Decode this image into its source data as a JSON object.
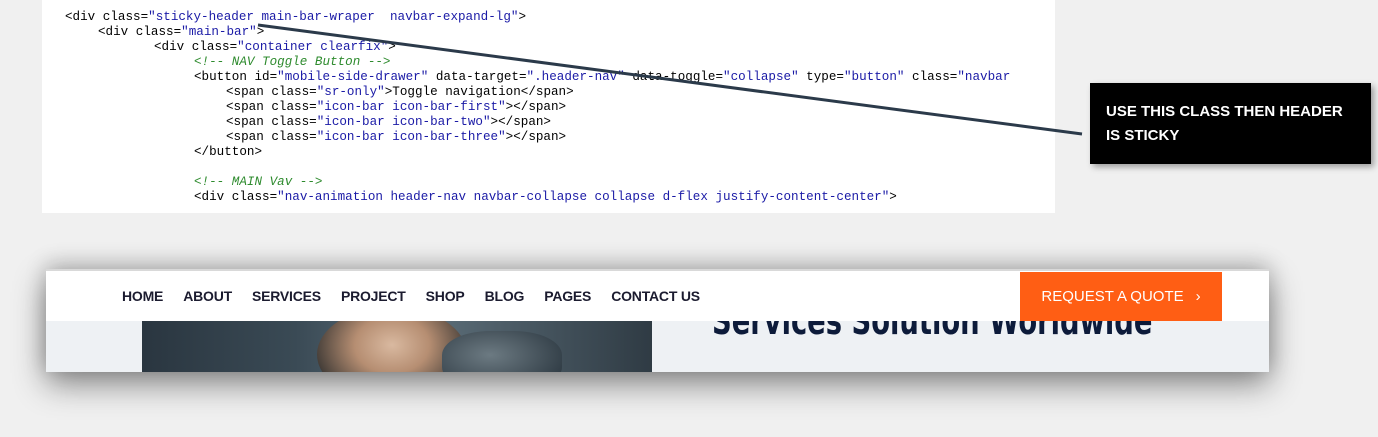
{
  "code": {
    "lines": [
      [
        {
          "t": "k",
          "s": "<div class="
        },
        {
          "t": "v",
          "s": "\"sticky-header main-bar-wraper  navbar-expand-lg\""
        },
        {
          "t": "k",
          "s": ">"
        }
      ],
      [
        {
          "t": "k",
          "s": "<div class="
        },
        {
          "t": "v",
          "s": "\"main-bar\""
        },
        {
          "t": "k",
          "s": ">"
        }
      ],
      [
        {
          "t": "k",
          "s": "<div class="
        },
        {
          "t": "v",
          "s": "\"container clearfix\""
        },
        {
          "t": "k",
          "s": ">"
        }
      ],
      [
        {
          "t": "c",
          "s": "<!-- NAV Toggle Button -->"
        }
      ],
      [
        {
          "t": "k",
          "s": "<button id="
        },
        {
          "t": "v",
          "s": "\"mobile-side-drawer\""
        },
        {
          "t": "k",
          "s": " data-target="
        },
        {
          "t": "v",
          "s": "\".header-nav\""
        },
        {
          "t": "k",
          "s": " data-toggle="
        },
        {
          "t": "v",
          "s": "\"collapse\""
        },
        {
          "t": "k",
          "s": " type="
        },
        {
          "t": "v",
          "s": "\"button\""
        },
        {
          "t": "k",
          "s": " class="
        },
        {
          "t": "v",
          "s": "\"navbar"
        }
      ],
      [
        {
          "t": "k",
          "s": "<span class="
        },
        {
          "t": "v",
          "s": "\"sr-only\""
        },
        {
          "t": "k",
          "s": ">Toggle navigation</span>"
        }
      ],
      [
        {
          "t": "k",
          "s": "<span class="
        },
        {
          "t": "v",
          "s": "\"icon-bar icon-bar-first\""
        },
        {
          "t": "k",
          "s": "></span>"
        }
      ],
      [
        {
          "t": "k",
          "s": "<span class="
        },
        {
          "t": "v",
          "s": "\"icon-bar icon-bar-two\""
        },
        {
          "t": "k",
          "s": "></span>"
        }
      ],
      [
        {
          "t": "k",
          "s": "<span class="
        },
        {
          "t": "v",
          "s": "\"icon-bar icon-bar-three\""
        },
        {
          "t": "k",
          "s": "></span>"
        }
      ],
      [
        {
          "t": "k",
          "s": "</button>"
        }
      ],
      [],
      [
        {
          "t": "c",
          "s": "<!-- MAIN Vav -->"
        }
      ],
      [
        {
          "t": "k",
          "s": "<div class="
        },
        {
          "t": "v",
          "s": "\"nav-animation header-nav navbar-collapse collapse d-flex justify-content-center\""
        },
        {
          "t": "k",
          "s": ">"
        }
      ]
    ]
  },
  "callout": {
    "text": "USE THIS CLASS THEN HEADER IS STICKY"
  },
  "site": {
    "nav_items": [
      "HOME",
      "ABOUT",
      "SERVICES",
      "PROJECT",
      "SHOP",
      "BLOG",
      "PAGES",
      "CONTACT US"
    ],
    "quote_button": "REQUEST A QUOTE",
    "quote_button_icon": "chevron-right-icon",
    "hero_headline": "Services Solution Worldwide",
    "accent_color": "#ff5e14"
  }
}
